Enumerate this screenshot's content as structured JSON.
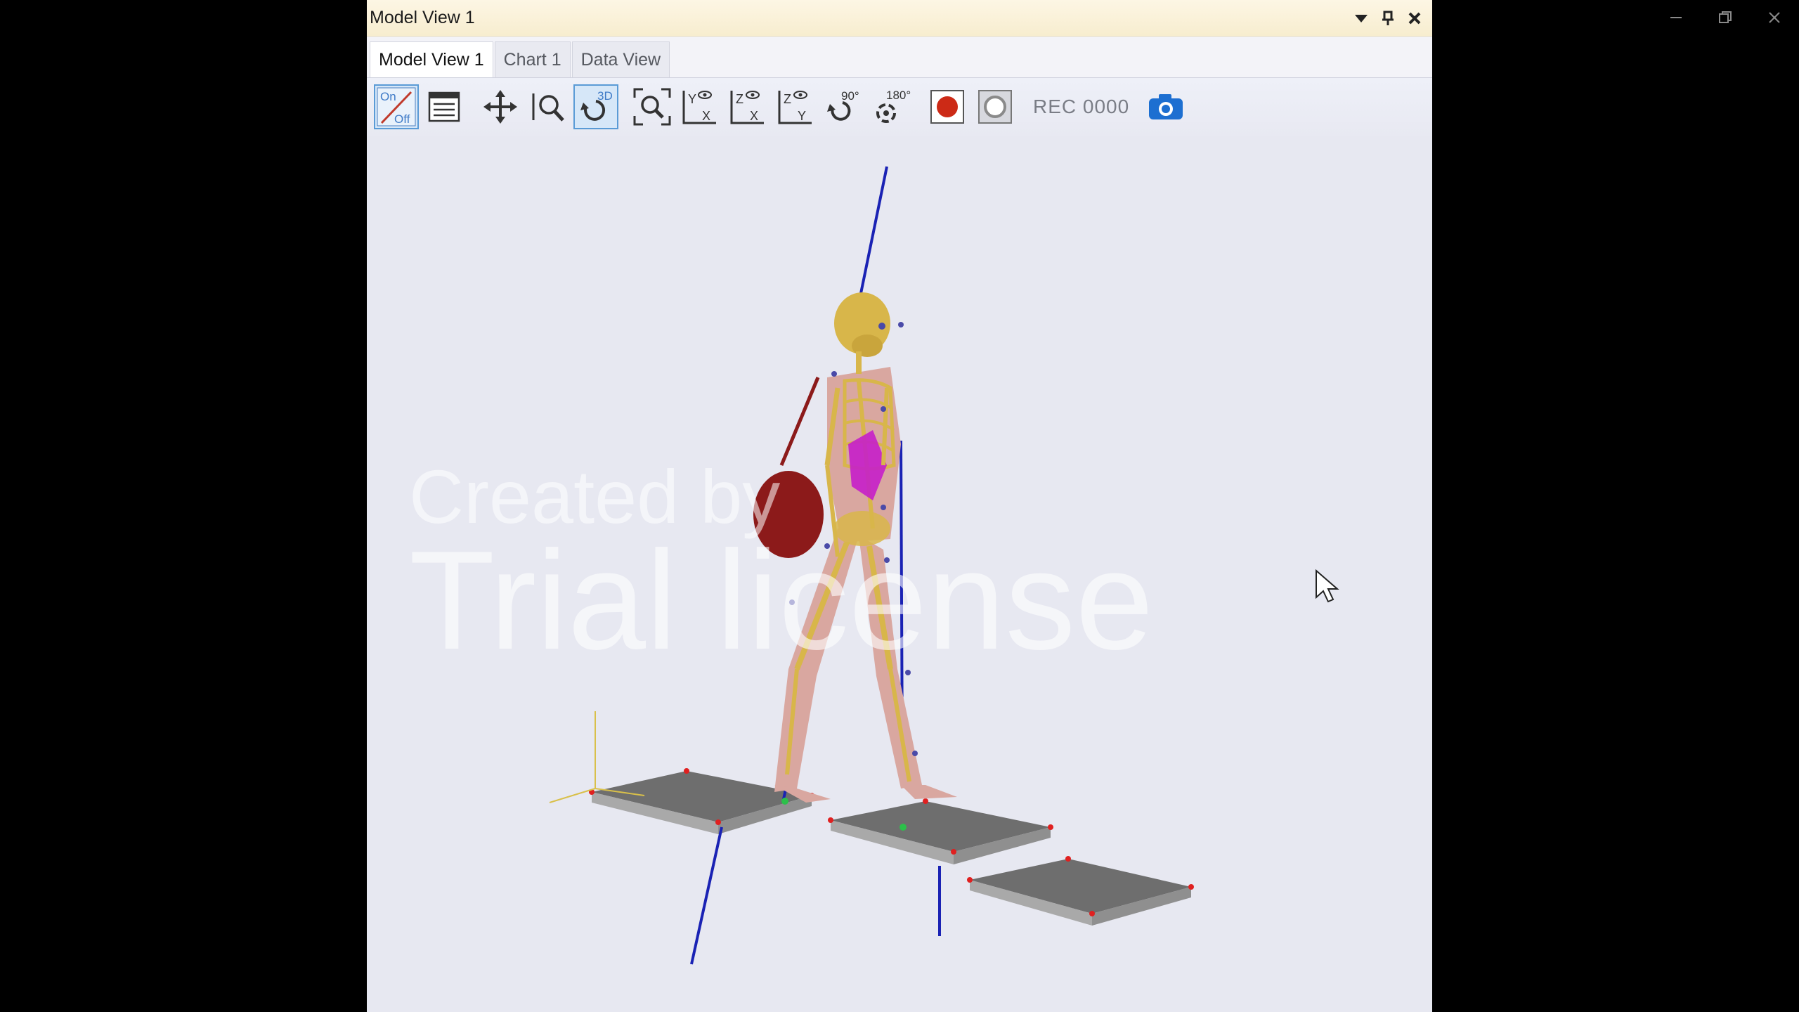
{
  "window": {
    "title": "Model View 1",
    "controls": [
      "dropdown-arrow-icon",
      "pin-icon",
      "close-icon"
    ]
  },
  "tabs": [
    {
      "label": "Model View 1",
      "active": true
    },
    {
      "label": "Chart 1",
      "active": false
    },
    {
      "label": "Data View",
      "active": false
    }
  ],
  "toolbar": {
    "onoff_label_top": "On",
    "onoff_label_bottom": "Off",
    "rotate3d_label": "3D",
    "rotate90_label": "90°",
    "rotate180_label": "180°",
    "view_yx_label_top": "Y",
    "view_yx_label_bottom": "X",
    "view_zx_label_top": "Z",
    "view_zx_label_bottom": "X",
    "view_zy_label_top": "Z",
    "view_zy_label_bottom": "Y",
    "rec_counter": "REC 0000"
  },
  "watermark": {
    "line1": "Created by",
    "line2": "Trial license"
  },
  "colors": {
    "record_red": "#cc2a16",
    "accent_blue": "#1d6fd1",
    "force_vector": "#1a22b4",
    "bone": "#d8b64a",
    "muscle": "#d9a7a0",
    "organs": "#c51fc9",
    "bag": "#8c1a1a",
    "plate": "#8a8a8a"
  }
}
